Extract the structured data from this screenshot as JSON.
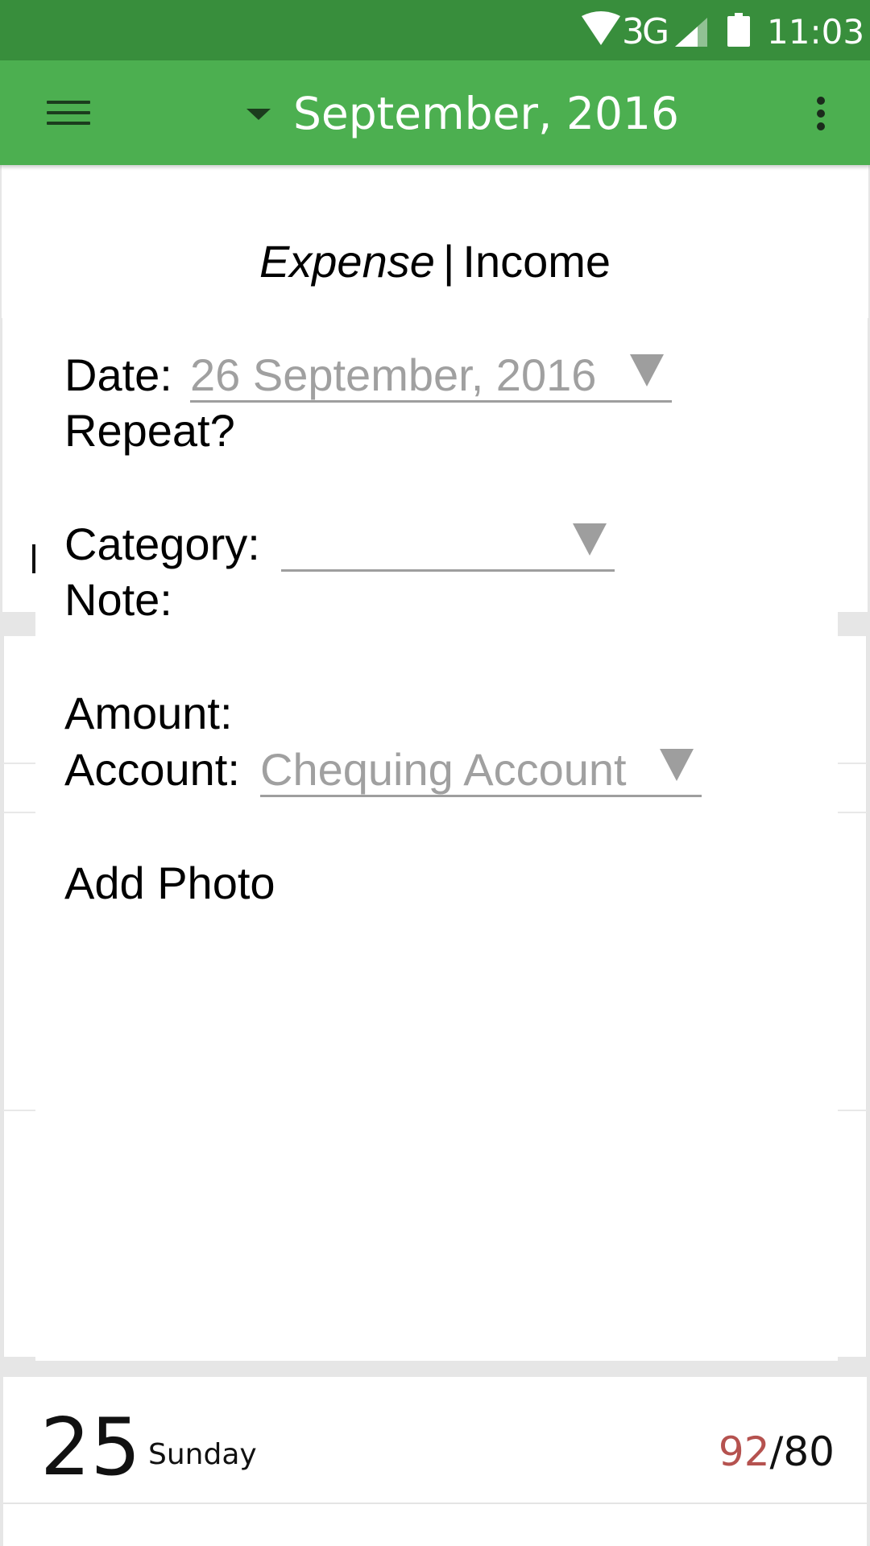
{
  "status_bar": {
    "network": "3G",
    "time": "11:03",
    "icons": [
      "wifi-icon",
      "signal-icon",
      "battery-icon"
    ]
  },
  "app_bar": {
    "menu_icon": "hamburger-menu-icon",
    "month_title": "September, 2016",
    "overflow_icon": "more-vert-icon"
  },
  "dialog": {
    "type_toggle": {
      "expense": "Expense",
      "separator": "|",
      "income": "Income",
      "selected": "Expense"
    },
    "date": {
      "label": "Date:",
      "value": "26 September, 2016"
    },
    "repeat": {
      "label": "Repeat?"
    },
    "category": {
      "label": "Category:",
      "value": ""
    },
    "note": {
      "label": "Note:"
    },
    "amount": {
      "label": "Amount:"
    },
    "account": {
      "label": "Account:",
      "value": "Chequing Account"
    },
    "add_photo": "Add Photo"
  },
  "day_row": {
    "day_number": "25",
    "day_name": "Sunday",
    "spent": "92",
    "separator": "/",
    "budget": "80"
  },
  "colors": {
    "status_bar": "#388e3c",
    "app_bar": "#4caf50",
    "over_budget": "#b5524f",
    "spinner_text": "#a0a0a0"
  }
}
